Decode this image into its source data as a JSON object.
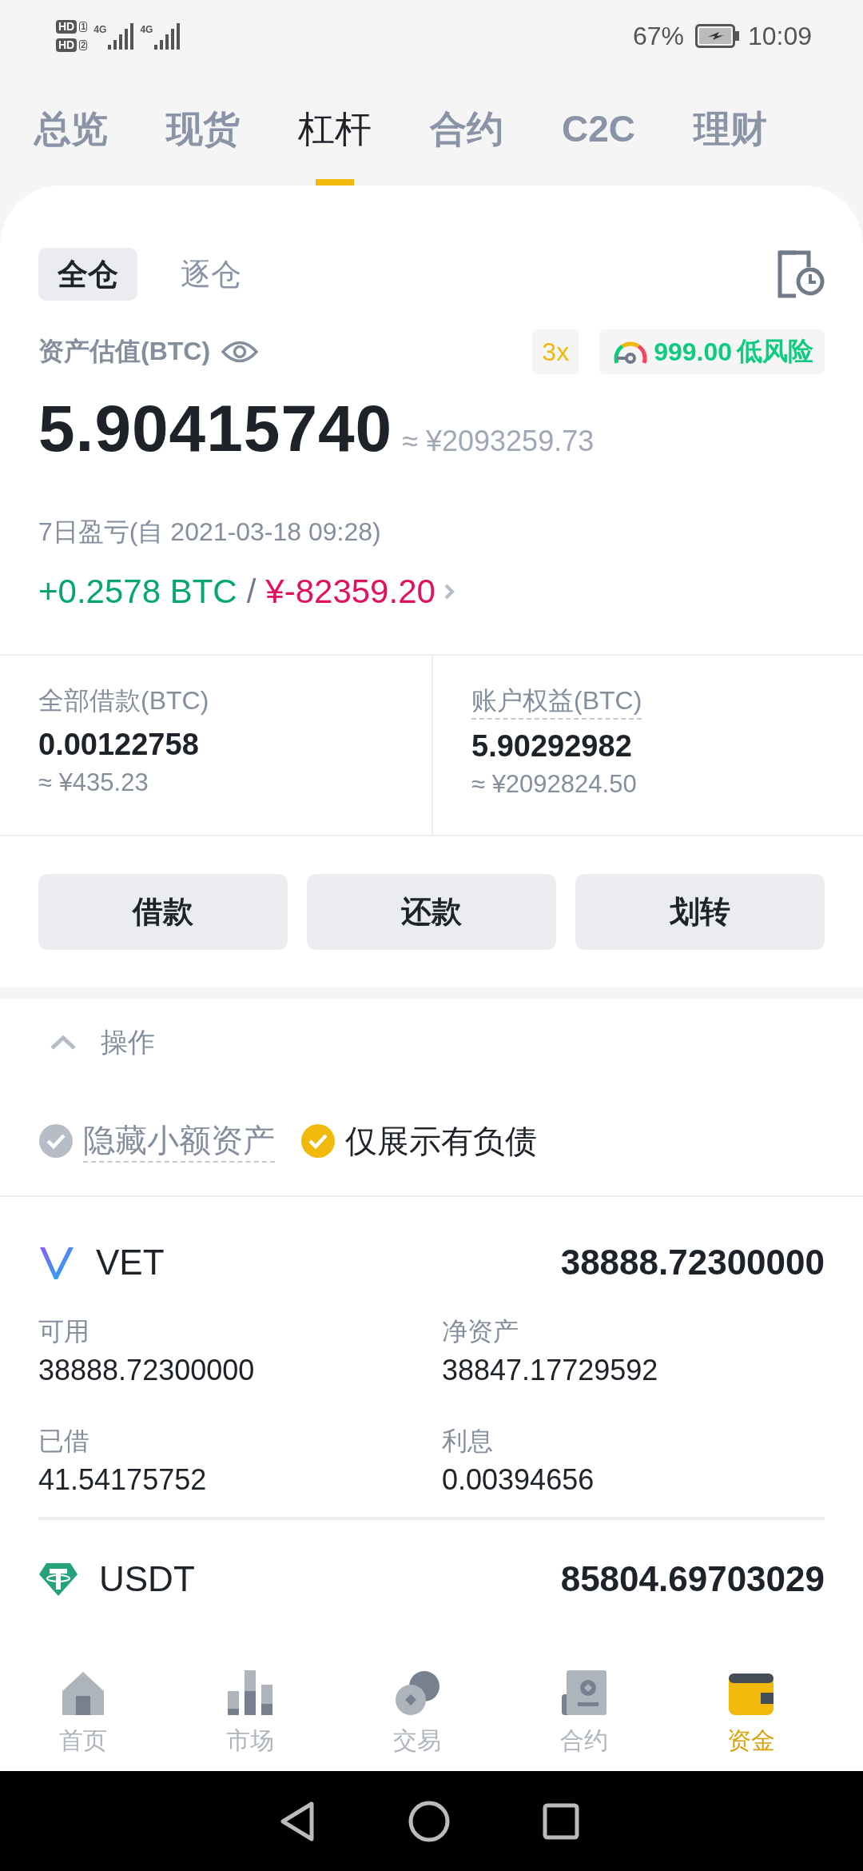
{
  "status_bar": {
    "sims": [
      {
        "badge": "HD",
        "slot": "1",
        "network": "4G"
      },
      {
        "badge": "HD",
        "slot": "2",
        "network": "4G"
      }
    ],
    "battery": "67%",
    "time": "10:09"
  },
  "tabs": [
    {
      "label": "总览",
      "selected": false
    },
    {
      "label": "现货",
      "selected": false
    },
    {
      "label": "杠杆",
      "selected": true
    },
    {
      "label": "合约",
      "selected": false
    },
    {
      "label": "C2C",
      "selected": false
    },
    {
      "label": "理财",
      "selected": false
    }
  ],
  "margin_modes": [
    {
      "label": "全仓",
      "selected": true
    },
    {
      "label": "逐仓",
      "selected": false
    }
  ],
  "asset_valuation": {
    "label": "资产估值(BTC)",
    "leverage": "3x",
    "risk_value": "999.00",
    "risk_label": "低风险",
    "total": "5.90415740",
    "total_cny": "≈ ¥2093259.73"
  },
  "pnl": {
    "label": "7日盈亏(自 2021-03-18 09:28)",
    "btc": "+0.2578 BTC",
    "separator": "/",
    "cny": "¥-82359.20"
  },
  "summary": [
    {
      "label": "全部借款(BTC)",
      "underlined": false,
      "value": "0.00122758",
      "approx": "≈ ¥435.23"
    },
    {
      "label": "账户权益(BTC)",
      "underlined": true,
      "value": "5.90292982",
      "approx": "≈ ¥2092824.50"
    }
  ],
  "actions": [
    "借款",
    "还款",
    "划转"
  ],
  "operations": {
    "label": "操作",
    "expanded": true
  },
  "filters": [
    {
      "label": "隐藏小额资产",
      "checked": false,
      "underlined": true
    },
    {
      "label": "仅展示有负债",
      "checked": true,
      "underlined": false
    }
  ],
  "assets": [
    {
      "kind": "vet",
      "symbol": "VET",
      "total": "38888.72300000",
      "fields": [
        {
          "label": "可用",
          "value": "38888.72300000"
        },
        {
          "label": "净资产",
          "value": "38847.17729592"
        },
        {
          "label": "已借",
          "value": "41.54175752"
        },
        {
          "label": "利息",
          "value": "0.00394656"
        }
      ]
    },
    {
      "kind": "usdt",
      "symbol": "USDT",
      "total": "85804.69703029"
    }
  ],
  "bottom_nav": [
    {
      "kind": "home",
      "label": "首页",
      "selected": false
    },
    {
      "kind": "market",
      "label": "市场",
      "selected": false
    },
    {
      "kind": "trade",
      "label": "交易",
      "selected": false
    },
    {
      "kind": "contract",
      "label": "合约",
      "selected": false
    },
    {
      "kind": "funds",
      "label": "资金",
      "selected": true
    }
  ]
}
